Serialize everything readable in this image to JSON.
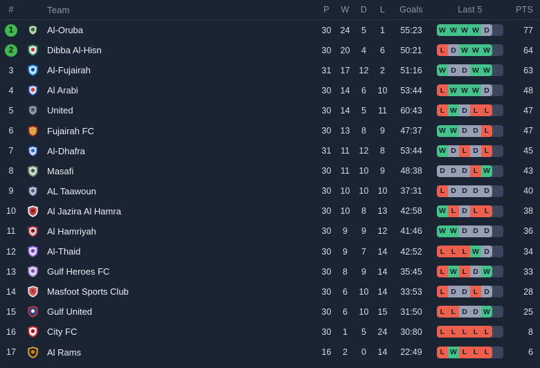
{
  "table": {
    "columns": {
      "rank": "#",
      "team": "Team",
      "played": "P",
      "won": "W",
      "drawn": "D",
      "lost": "L",
      "goals": "Goals",
      "last5": "Last 5",
      "points": "PTS"
    },
    "colors": {
      "background": "#1b2433",
      "win": "#43c38a",
      "draw": "#99a0b5",
      "loss": "#ee5f4d",
      "track": "#3a465c",
      "promotion_badge": "#3fb84f",
      "header_text": "#8b94a8",
      "body_text": "#e8ebf0"
    },
    "rows": [
      {
        "rank": "1",
        "promoted": true,
        "team": "Al-Oruba",
        "played": "30",
        "won": "24",
        "drawn": "5",
        "lost": "1",
        "goals": "55:23",
        "last5": [
          "W",
          "W",
          "W",
          "W",
          "D"
        ],
        "points": "77",
        "crest": {
          "primary": "#16301e",
          "secondary": "#cfd8d0",
          "accent": "#2f6b3c"
        }
      },
      {
        "rank": "2",
        "promoted": true,
        "team": "Dibba Al-Hisn",
        "played": "30",
        "won": "20",
        "drawn": "4",
        "lost": "6",
        "goals": "50:21",
        "last5": [
          "L",
          "D",
          "W",
          "W",
          "W"
        ],
        "points": "64",
        "crest": {
          "primary": "#2f7d4f",
          "secondary": "#f0f2f5",
          "accent": "#b33a3a"
        }
      },
      {
        "rank": "3",
        "promoted": false,
        "team": "Al-Fujairah",
        "played": "31",
        "won": "17",
        "drawn": "12",
        "lost": "2",
        "goals": "51:16",
        "last5": [
          "W",
          "D",
          "D",
          "W",
          "W"
        ],
        "points": "63",
        "crest": {
          "primary": "#1f7fd4",
          "secondary": "#d6ecff",
          "accent": "#0d4f8c"
        }
      },
      {
        "rank": "4",
        "promoted": false,
        "team": "Al Arabi",
        "played": "30",
        "won": "14",
        "drawn": "6",
        "lost": "10",
        "goals": "53:44",
        "last5": [
          "L",
          "W",
          "W",
          "W",
          "D"
        ],
        "points": "48",
        "crest": {
          "primary": "#1b3f8f",
          "secondary": "#e3e9f7",
          "accent": "#d33a3a"
        }
      },
      {
        "rank": "5",
        "promoted": false,
        "team": "United",
        "played": "30",
        "won": "14",
        "drawn": "5",
        "lost": "11",
        "goals": "60:43",
        "last5": [
          "L",
          "W",
          "D",
          "L",
          "L"
        ],
        "points": "47",
        "crest": {
          "primary": "#2a2f3a",
          "secondary": "#9aa3b4",
          "accent": "#4a5060"
        }
      },
      {
        "rank": "6",
        "promoted": false,
        "team": "Fujairah FC",
        "played": "30",
        "won": "13",
        "drawn": "8",
        "lost": "9",
        "goals": "47:37",
        "last5": [
          "W",
          "W",
          "D",
          "D",
          "L"
        ],
        "points": "47",
        "crest": {
          "primary": "#8a2222",
          "secondary": "#e8b24a",
          "accent": "#d9a43f"
        }
      },
      {
        "rank": "7",
        "promoted": false,
        "team": "Al-Dhafra",
        "played": "31",
        "won": "11",
        "drawn": "12",
        "lost": "8",
        "goals": "53:44",
        "last5": [
          "W",
          "D",
          "L",
          "D",
          "L"
        ],
        "points": "45",
        "crest": {
          "primary": "#1c3f8a",
          "secondary": "#dfe7f5",
          "accent": "#2f6fc4"
        }
      },
      {
        "rank": "8",
        "promoted": false,
        "team": "Masafi",
        "played": "30",
        "won": "11",
        "drawn": "10",
        "lost": "9",
        "goals": "48:38",
        "last5": [
          "D",
          "D",
          "D",
          "L",
          "W"
        ],
        "points": "43",
        "crest": {
          "primary": "#6e8a72",
          "secondary": "#dbe6dc",
          "accent": "#3f5c45"
        }
      },
      {
        "rank": "9",
        "promoted": false,
        "team": "AL Taawoun",
        "played": "30",
        "won": "10",
        "drawn": "10",
        "lost": "10",
        "goals": "37:31",
        "last5": [
          "L",
          "D",
          "D",
          "D",
          "D"
        ],
        "points": "40",
        "crest": {
          "primary": "#2b3550",
          "secondary": "#c9d2e2",
          "accent": "#55607a"
        }
      },
      {
        "rank": "10",
        "promoted": false,
        "team": "Al Jazira Al Hamra",
        "played": "30",
        "won": "10",
        "drawn": "8",
        "lost": "13",
        "goals": "42:58",
        "last5": [
          "W",
          "L",
          "D",
          "L",
          "L"
        ],
        "points": "38",
        "crest": {
          "primary": "#f2f4f7",
          "secondary": "#c33434",
          "accent": "#8a1f1f"
        }
      },
      {
        "rank": "11",
        "promoted": false,
        "team": "Al Hamriyah",
        "played": "30",
        "won": "9",
        "drawn": "9",
        "lost": "12",
        "goals": "41:46",
        "last5": [
          "W",
          "W",
          "D",
          "D",
          "D"
        ],
        "points": "36",
        "crest": {
          "primary": "#9e2b3f",
          "secondary": "#ead7d9",
          "accent": "#6d1c2c"
        }
      },
      {
        "rank": "12",
        "promoted": false,
        "team": "Al-Thaid",
        "played": "30",
        "won": "9",
        "drawn": "7",
        "lost": "14",
        "goals": "42:52",
        "last5": [
          "L",
          "L",
          "L",
          "W",
          "D"
        ],
        "points": "34",
        "crest": {
          "primary": "#8b5fd6",
          "secondary": "#ece3fa",
          "accent": "#6a3fb0"
        }
      },
      {
        "rank": "13",
        "promoted": false,
        "team": "Gulf Heroes FC",
        "played": "30",
        "won": "8",
        "drawn": "9",
        "lost": "14",
        "goals": "35:45",
        "last5": [
          "L",
          "W",
          "L",
          "D",
          "W"
        ],
        "points": "33",
        "crest": {
          "primary": "#9b7fd4",
          "secondary": "#eae2f7",
          "accent": "#6f54a8"
        }
      },
      {
        "rank": "14",
        "promoted": false,
        "team": "Masfoot Sports Club",
        "played": "30",
        "won": "6",
        "drawn": "10",
        "lost": "14",
        "goals": "33:53",
        "last5": [
          "L",
          "D",
          "D",
          "L",
          "D"
        ],
        "points": "28",
        "crest": {
          "primary": "#e8e2e0",
          "secondary": "#d14a4a",
          "accent": "#b03636"
        }
      },
      {
        "rank": "15",
        "promoted": false,
        "team": "Gulf United",
        "played": "30",
        "won": "6",
        "drawn": "10",
        "lost": "15",
        "goals": "31:50",
        "last5": [
          "L",
          "L",
          "D",
          "D",
          "W"
        ],
        "points": "25",
        "crest": {
          "primary": "#c23a3a",
          "secondary": "#1f3f8c",
          "accent": "#e8eaf0"
        }
      },
      {
        "rank": "16",
        "promoted": false,
        "team": "City FC",
        "played": "30",
        "won": "1",
        "drawn": "5",
        "lost": "24",
        "goals": "30:80",
        "last5": [
          "L",
          "L",
          "L",
          "L",
          "L"
        ],
        "points": "8",
        "crest": {
          "primary": "#d02c2c",
          "secondary": "#f5f6f8",
          "accent": "#8c1c1c"
        }
      },
      {
        "rank": "17",
        "promoted": false,
        "team": "Al Rams",
        "played": "16",
        "won": "2",
        "drawn": "0",
        "lost": "14",
        "goals": "22:49",
        "last5": [
          "L",
          "W",
          "L",
          "L",
          "L"
        ],
        "points": "6",
        "crest": {
          "primary": "#e8a83a",
          "secondary": "#1a1a1a",
          "accent": "#c98a22"
        }
      }
    ]
  }
}
